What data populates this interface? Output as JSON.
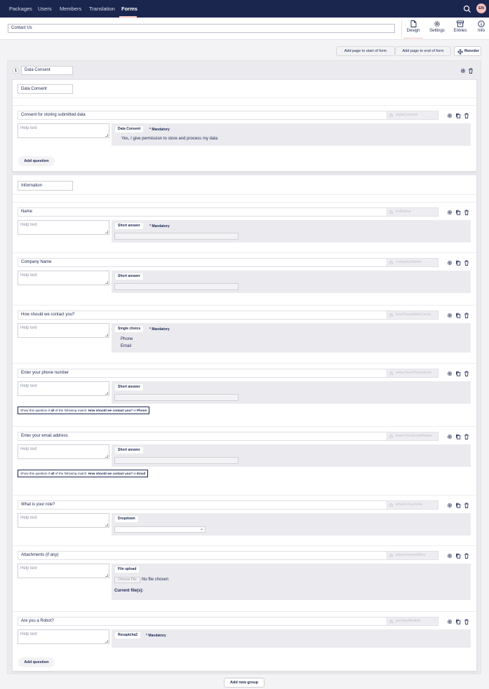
{
  "nav": {
    "items": [
      "Packages",
      "Users",
      "Members",
      "Translation",
      "Forms"
    ],
    "active": "Forms",
    "lang": "EN"
  },
  "form": {
    "name": "Contact Us"
  },
  "app_tabs": [
    "Design",
    "Settings",
    "Entries",
    "Info"
  ],
  "toolbar": {
    "add_start": "Add page to start of form",
    "add_end": "Add page to end of form",
    "reorder": "Reorder"
  },
  "page": {
    "number": "1",
    "name": "Data Consent"
  },
  "sections": [
    {
      "name": "Data Consent"
    },
    {
      "name": "Information"
    }
  ],
  "questions": [
    {
      "title": "Consent for storing submitted data",
      "alias": "dataConsent",
      "help": "Help text",
      "type": "Data Consent",
      "mandatory": "* Mandatory",
      "text": "Yes, I give permission to store and process my data"
    },
    {
      "title": "Name",
      "alias": "fullName",
      "help": "Help text",
      "type": "Short answer",
      "mandatory": "* Mandatory"
    },
    {
      "title": "Company Name",
      "alias": "companyName",
      "help": "Help text",
      "type": "Short answer"
    },
    {
      "title": "How should we contact you?",
      "alias": "howShouldWeConta",
      "help": "Help text",
      "type": "Single choice",
      "mandatory": "* Mandatory",
      "options": [
        "Phone",
        "Email"
      ]
    },
    {
      "title": "Enter your phone number",
      "alias": "enterYourPhoneNum",
      "help": "Help text",
      "type": "Short answer",
      "cond_pre": "Show this question if ",
      "cond_all": "all",
      "cond_mid": " of the following match: ",
      "cond_q": "How should we contact you?",
      "cond_is": " is ",
      "cond_val": "Phone"
    },
    {
      "title": "Enter your email address",
      "alias": "enterYourEmailAddre",
      "help": "Help text",
      "type": "Short answer",
      "cond_pre": "Show this question if ",
      "cond_all": "all",
      "cond_mid": " of the following match: ",
      "cond_q": "How should we contact you?",
      "cond_is": " is ",
      "cond_val": "Email"
    },
    {
      "title": "What is your role?",
      "alias": "whatIsYourRole",
      "help": "Help text",
      "type": "Dropdown"
    },
    {
      "title": "Attachments (if any)",
      "alias": "attachmentsIfAny",
      "help": "Help text",
      "type": "File upload",
      "choose": "Choose File",
      "nofile": "No file chosen",
      "current": "Current file(s):"
    },
    {
      "title": "Are you a Robot?",
      "alias": "areYouARobot",
      "help": "Help text",
      "type": "Recaptcha2",
      "mandatory": "* Mandatory"
    }
  ],
  "add_question": "Add question",
  "add_group": "Add new group"
}
